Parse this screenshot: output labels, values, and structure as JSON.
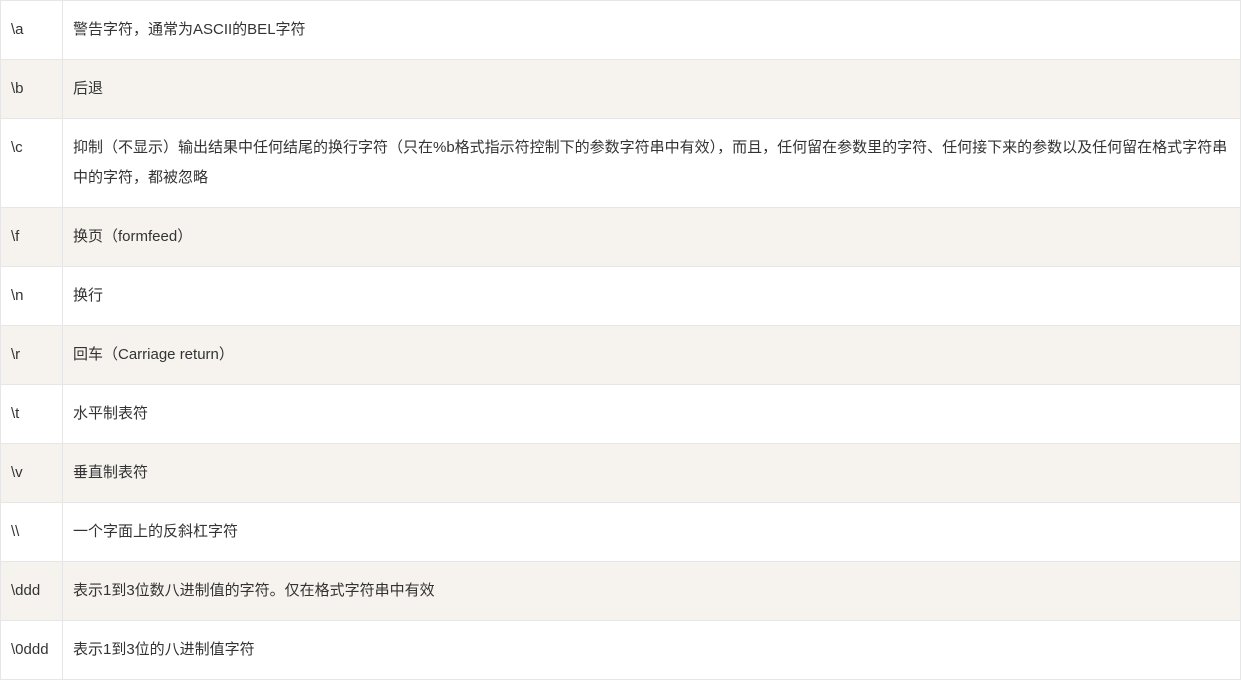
{
  "table": {
    "rows": [
      {
        "code": "\\a",
        "desc": "警告字符，通常为ASCII的BEL字符"
      },
      {
        "code": "\\b",
        "desc": "后退"
      },
      {
        "code": "\\c",
        "desc": "抑制（不显示）输出结果中任何结尾的换行字符（只在%b格式指示符控制下的参数字符串中有效），而且，任何留在参数里的字符、任何接下来的参数以及任何留在格式字符串中的字符，都被忽略"
      },
      {
        "code": "\\f",
        "desc": "换页（formfeed）"
      },
      {
        "code": "\\n",
        "desc": "换行"
      },
      {
        "code": "\\r",
        "desc": "回车（Carriage return）"
      },
      {
        "code": "\\t",
        "desc": "水平制表符"
      },
      {
        "code": "\\v",
        "desc": "垂直制表符"
      },
      {
        "code": "\\\\",
        "desc": "一个字面上的反斜杠字符"
      },
      {
        "code": "\\ddd",
        "desc": "表示1到3位数八进制值的字符。仅在格式字符串中有效"
      },
      {
        "code": "\\0ddd",
        "desc": "表示1到3位的八进制值字符"
      }
    ]
  }
}
